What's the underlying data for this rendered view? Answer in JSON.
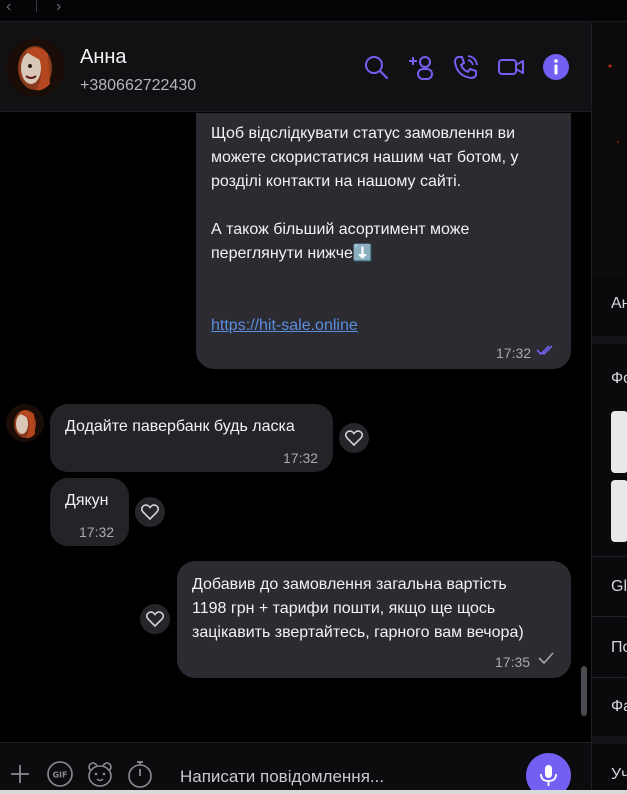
{
  "window": {
    "back_glyph": "‹",
    "forward_glyph": "›"
  },
  "header": {
    "name": "Анна",
    "phone": "+380662722430",
    "icons": [
      "search-icon",
      "add-participant-icon",
      "call-icon",
      "video-call-icon",
      "info-icon"
    ],
    "accent_color": "#7360f2"
  },
  "messages": [
    {
      "direction": "outgoing",
      "lines": [
        "Щоб відслідкувати статус замовлення ви",
        "можете скористатися нашим чат ботом, у",
        "розділі контакти на нашому сайті.",
        "",
        "А також більший асортимент може",
        "переглянути  нижче⬇️"
      ],
      "link": "https://hit-sale.online",
      "time": "17:32",
      "status": "read"
    },
    {
      "direction": "incoming",
      "lines": [
        "Додайте павербанк  будь ласка"
      ],
      "time": "17:32"
    },
    {
      "direction": "incoming",
      "lines": [
        "Дякун"
      ],
      "time": "17:32"
    },
    {
      "direction": "outgoing",
      "lines": [
        "Добавив до замовлення загальна вартість",
        "1198 грн + тарифи пошти, якщо ще щось",
        "зацікавить звертайтесь, гарного вам вечора)"
      ],
      "time": "17:35",
      "status": "delivered"
    }
  ],
  "composer": {
    "placeholder": "Написати повідомлення...",
    "icons": [
      "plus-icon",
      "gif-icon",
      "sticker-icon",
      "timer-icon",
      "microphone-icon"
    ]
  },
  "side_panel": {
    "items": [
      "Ан",
      "Фо",
      "Gl",
      "По",
      "Фа",
      "Уч"
    ]
  }
}
